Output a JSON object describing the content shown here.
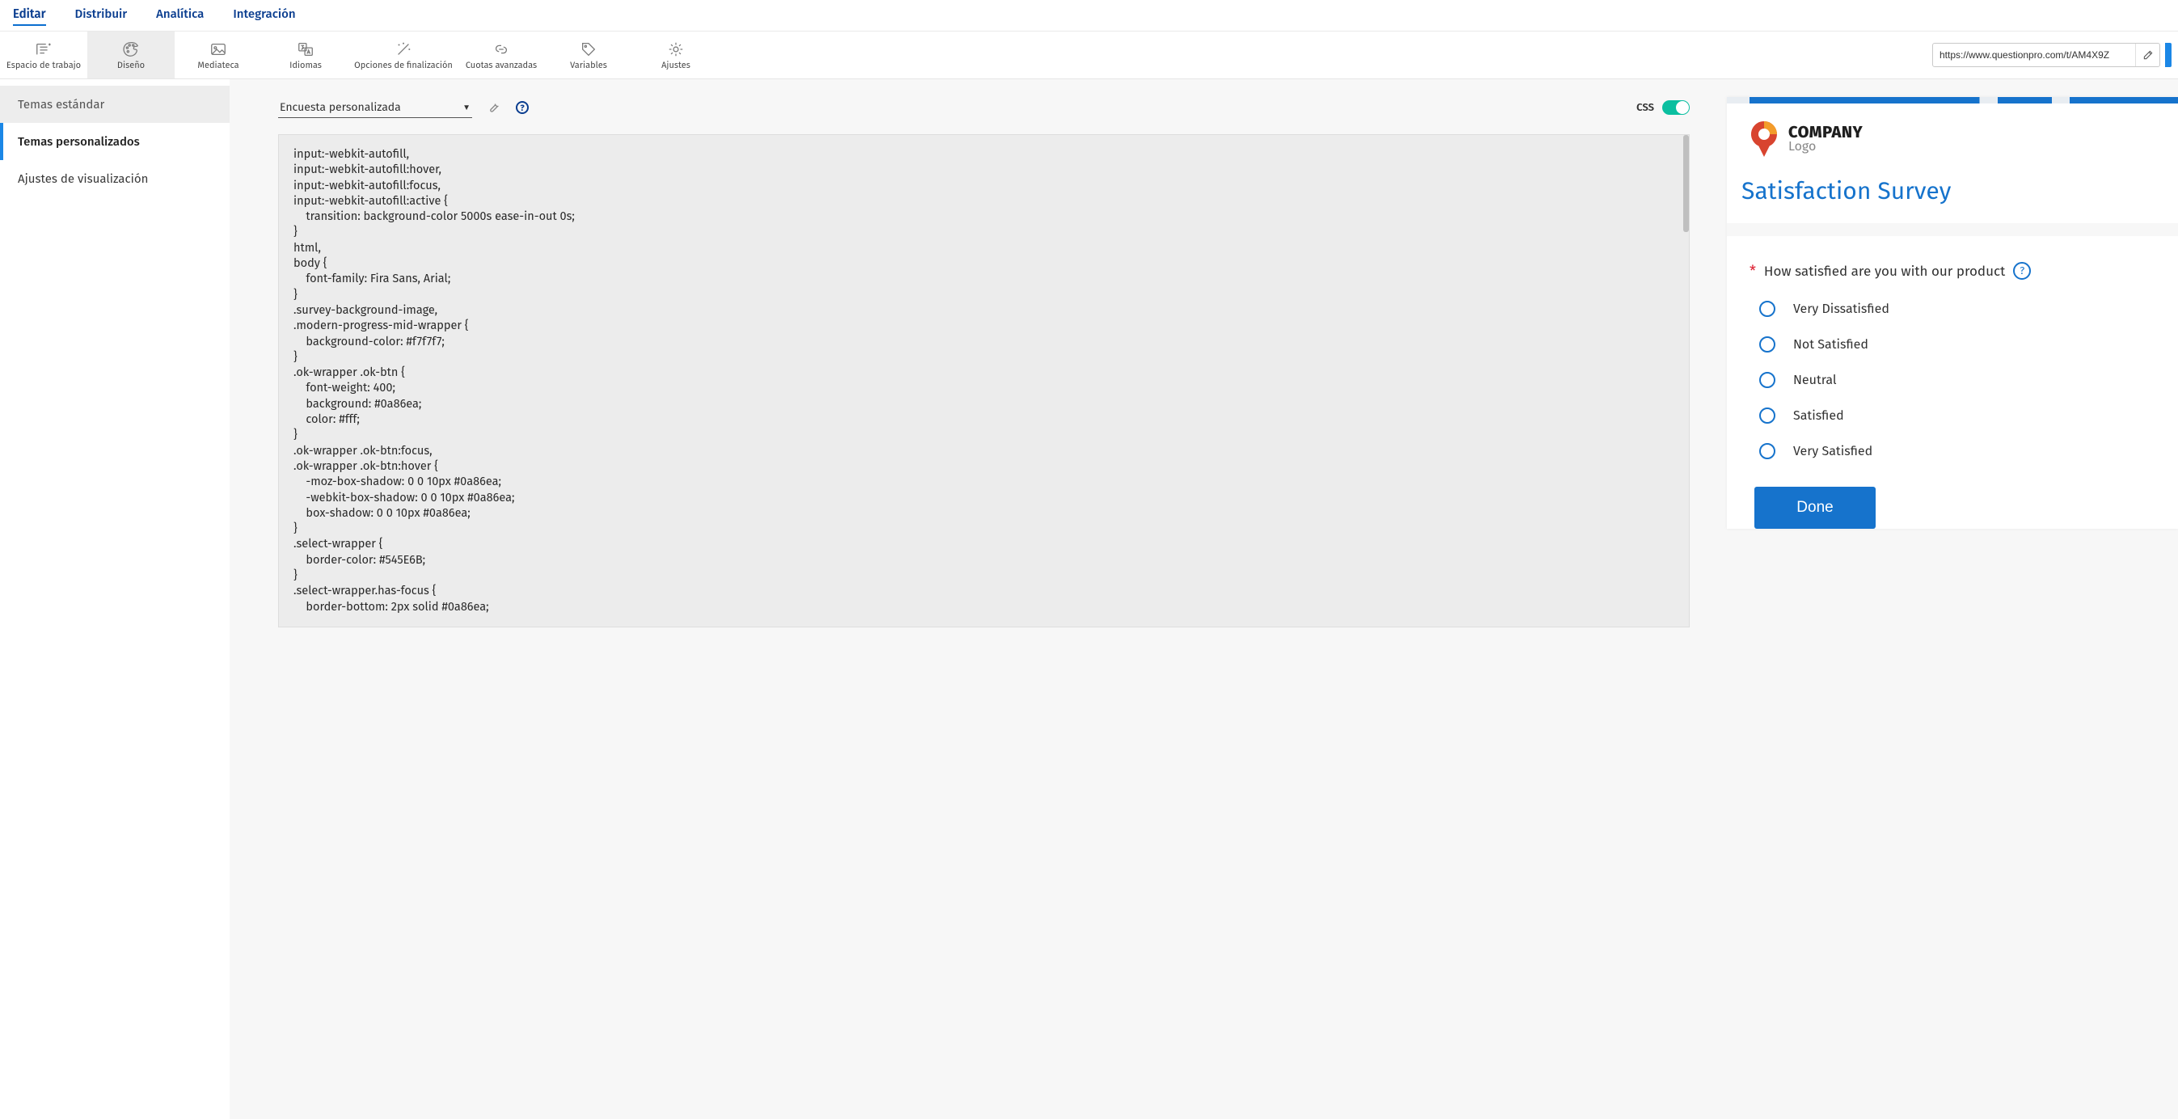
{
  "topnav": {
    "editar": "Editar",
    "distribuir": "Distribuir",
    "analitica": "Analítica",
    "integracion": "Integración"
  },
  "toolbar": {
    "workspace": "Espacio de trabajo",
    "design": "Diseño",
    "media": "Mediateca",
    "languages": "Idiomas",
    "finish_opts": "Opciones de finalización",
    "quotas": "Cuotas avanzadas",
    "variables": "Variables",
    "settings": "Ajustes",
    "url_value": "https://www.questionpro.com/t/AM4X9Z"
  },
  "sidebar": {
    "standard": "Temas estándar",
    "custom": "Temas personalizados",
    "display": "Ajustes de visualización"
  },
  "editor": {
    "select_label": "Encuesta personalizada",
    "css_label": "CSS",
    "code": "input:-webkit-autofill,\ninput:-webkit-autofill:hover,\ninput:-webkit-autofill:focus,\ninput:-webkit-autofill:active {\n    transition: background-color 5000s ease-in-out 0s;\n}\nhtml,\nbody {\n    font-family: Fira Sans, Arial;\n}\n.survey-background-image,\n.modern-progress-mid-wrapper {\n    background-color: #f7f7f7;\n}\n.ok-wrapper .ok-btn {\n    font-weight: 400;\n    background: #0a86ea;\n    color: #fff;\n}\n.ok-wrapper .ok-btn:focus,\n.ok-wrapper .ok-btn:hover {\n    -moz-box-shadow: 0 0 10px #0a86ea;\n    -webkit-box-shadow: 0 0 10px #0a86ea;\n    box-shadow: 0 0 10px #0a86ea;\n}\n.select-wrapper {\n    border-color: #545E6B;\n}\n.select-wrapper.has-focus {\n    border-bottom: 2px solid #0a86ea;"
  },
  "preview": {
    "brand_main": "COMPANY",
    "brand_sub": "Logo",
    "title": "Satisfaction Survey",
    "question": "How satisfied are you with our product",
    "opts": [
      "Very Dissatisfied",
      "Not Satisfied",
      "Neutral",
      "Satisfied",
      "Very Satisfied"
    ],
    "done": "Done"
  }
}
